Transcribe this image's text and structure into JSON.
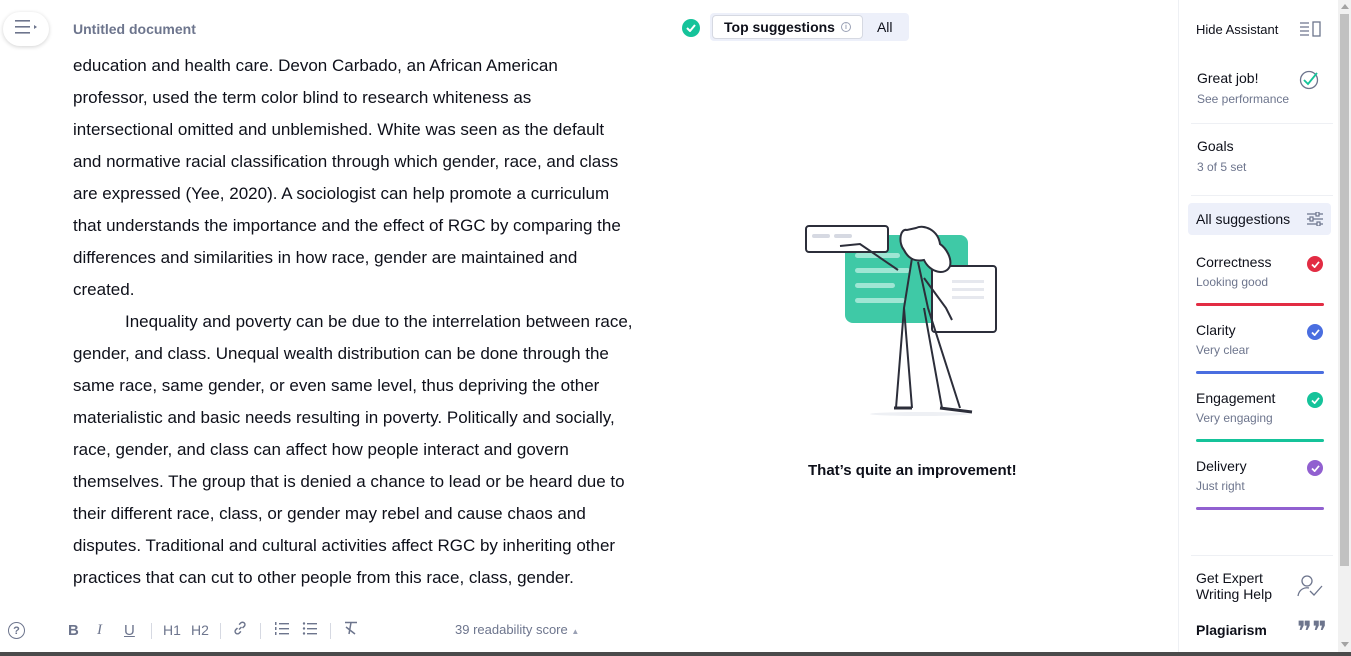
{
  "document": {
    "title": "Untitled document",
    "paragraphs": [
      {
        "text": "education and health care. Devon Carbado, an African American professor, used the term color blind to research whiteness as intersectional omitted and unblemished. White was seen as the default and normative racial classification through which gender, race, and class are expressed (Yee, 2020). A sociologist can help promote a curriculum that understands the importance and the effect of RGC by comparing the differences and similarities in how race, gender are maintained and created."
      },
      {
        "text": "Inequality and poverty can be due to the interrelation between race, gender, and class. Unequal wealth distribution can be done through the same race, same gender, or even same level, thus depriving the other materialistic and basic needs resulting in poverty. Politically and socially, race, gender, and class can affect how people interact and govern themselves. The group that is denied a chance to lead or be heard due to their different race, class, or gender may rebel and cause chaos and disputes. Traditional and cultural activities affect RGC by inheriting other practices that can cut to other people from this race, class, gender."
      }
    ]
  },
  "toolbar": {
    "help": "?",
    "bold": "B",
    "italic": "I",
    "underline": "U",
    "h1": "H1",
    "h2": "H2",
    "readability": "39 readability score",
    "readability_arrow": "▲"
  },
  "suggestions": {
    "top_label": "Top suggestions",
    "info_glyph": "i",
    "all_label": "All",
    "message": "That’s quite an improvement!"
  },
  "sidebar": {
    "hide_label": "Hide Assistant",
    "performance": {
      "title": "Great job!",
      "sub": "See performance"
    },
    "goals": {
      "title": "Goals",
      "sub": "3 of 5 set"
    },
    "all_suggestions": "All suggestions",
    "categories": [
      {
        "name": "Correctness",
        "status": "Looking good",
        "color": "#e22c43"
      },
      {
        "name": "Clarity",
        "status": "Very clear",
        "color": "#4a6ee0"
      },
      {
        "name": "Engagement",
        "status": "Very engaging",
        "color": "#15c39a"
      },
      {
        "name": "Delivery",
        "status": "Just right",
        "color": "#9160d0"
      }
    ],
    "expert_line1": "Get Expert",
    "expert_line2": "Writing Help",
    "plagiarism": "Plagiarism",
    "plagiarism_glyph": "❞❞"
  },
  "icons": {
    "menu": "menu-icon",
    "check": "check-icon",
    "link": "link-icon",
    "ordered_list": "ordered-list-icon",
    "bullet_list": "bullet-list-icon",
    "clear_format": "clear-format-icon",
    "hide_assistant": "sidebar-toggle-icon",
    "filter": "filter-icon",
    "expert": "expert-user-icon",
    "plagiarism": "quote-icon"
  },
  "colors": {
    "accent": "#15c39a",
    "correctness": "#e22c43",
    "clarity": "#4a6ee0",
    "engagement": "#15c39a",
    "delivery": "#9160d0"
  }
}
